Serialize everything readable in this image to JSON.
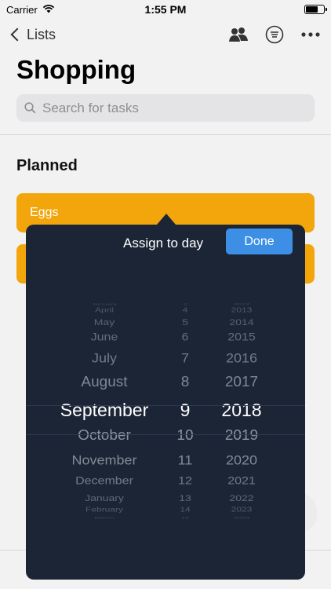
{
  "status_bar": {
    "carrier": "Carrier",
    "time": "1:55 PM"
  },
  "nav": {
    "back_label": "Lists"
  },
  "page": {
    "title": "Shopping",
    "search_placeholder": "Search for tasks",
    "section_title": "Planned"
  },
  "tasks": [
    {
      "label": "Eggs"
    },
    {
      "label": ""
    }
  ],
  "popover": {
    "title": "Assign to day",
    "done_label": "Done",
    "months": [
      "January",
      "April",
      "May",
      "June",
      "July",
      "August",
      "September",
      "October",
      "November",
      "December",
      "January",
      "February",
      "March"
    ],
    "days": [
      "3",
      "4",
      "5",
      "6",
      "7",
      "8",
      "9",
      "10",
      "11",
      "12",
      "13",
      "14",
      "15"
    ],
    "years": [
      "2012",
      "2013",
      "2014",
      "2015",
      "2016",
      "2017",
      "2018",
      "2019",
      "2020",
      "2021",
      "2022",
      "2023",
      "2024"
    ],
    "selected": {
      "month": "September",
      "day": "9",
      "year": "2018"
    }
  },
  "colors": {
    "accent": "#f2a60c",
    "done_button": "#3d8fe6",
    "popover_bg": "#1c2536"
  },
  "icons": {
    "back": "chevron-left-icon",
    "share": "people-icon",
    "filter": "filter-lines-icon",
    "more": "ellipsis-icon",
    "search": "magnifier-icon",
    "wifi": "wifi-icon",
    "battery": "battery-icon"
  }
}
